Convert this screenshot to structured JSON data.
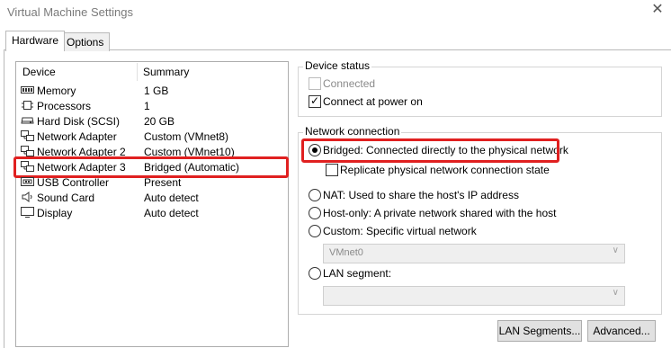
{
  "window": {
    "title": "Virtual Machine Settings",
    "close_glyph": "✕"
  },
  "tabs": [
    {
      "label": "Hardware",
      "active": true
    },
    {
      "label": "Options",
      "active": false
    }
  ],
  "device_list": {
    "col_device": "Device",
    "col_summary": "Summary",
    "rows": [
      {
        "name": "Memory",
        "summary": "1 GB",
        "icon": "memory-icon"
      },
      {
        "name": "Processors",
        "summary": "1",
        "icon": "processor-icon"
      },
      {
        "name": "Hard Disk (SCSI)",
        "summary": "20 GB",
        "icon": "hard-disk-icon"
      },
      {
        "name": "Network Adapter",
        "summary": "Custom (VMnet8)",
        "icon": "network-adapter-icon"
      },
      {
        "name": "Network Adapter 2",
        "summary": "Custom (VMnet10)",
        "icon": "network-adapter-icon"
      },
      {
        "name": "Network Adapter 3",
        "summary": "Bridged (Automatic)",
        "icon": "network-adapter-icon",
        "highlighted": true
      },
      {
        "name": "USB Controller",
        "summary": "Present",
        "icon": "usb-icon"
      },
      {
        "name": "Sound Card",
        "summary": "Auto detect",
        "icon": "speaker-icon"
      },
      {
        "name": "Display",
        "summary": "Auto detect",
        "icon": "display-icon"
      }
    ]
  },
  "device_status": {
    "legend": "Device status",
    "connected": {
      "label": "Connected",
      "checked": false,
      "disabled": true
    },
    "connect_at_power_on": {
      "label": "Connect at power on",
      "checked": true
    }
  },
  "network_connection": {
    "legend": "Network connection",
    "bridged": {
      "label": "Bridged: Connected directly to the physical network",
      "selected": true
    },
    "replicate": {
      "label": "Replicate physical network connection state",
      "checked": false
    },
    "nat": {
      "label": "NAT: Used to share the host's IP address",
      "selected": false
    },
    "host_only": {
      "label": "Host-only: A private network shared with the host",
      "selected": false
    },
    "custom": {
      "label": "Custom: Specific virtual network",
      "selected": false,
      "combo_value": "VMnet0"
    },
    "lan_segment": {
      "label": "LAN segment:",
      "selected": false,
      "combo_value": ""
    }
  },
  "buttons": {
    "lan_segments": "LAN Segments...",
    "advanced": "Advanced..."
  },
  "colors": {
    "highlight": "#e02020"
  }
}
